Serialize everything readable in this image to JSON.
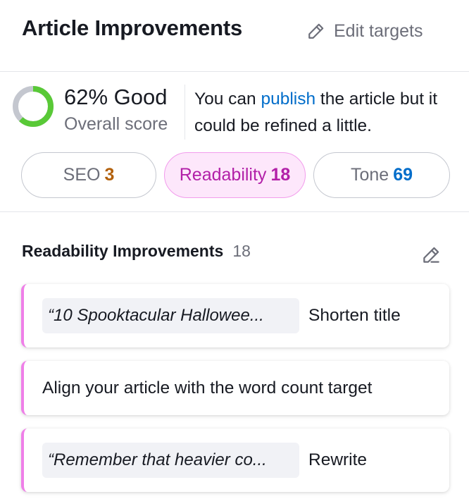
{
  "header": {
    "title": "Article Improvements",
    "edit_targets_label": "Edit targets",
    "edit_icon": "pencil-icon"
  },
  "score": {
    "percent": 62,
    "value_text": "62% Good",
    "label": "Overall score",
    "ring_color": "#59c937",
    "track_color": "#c4c7cf",
    "message_before": "You can ",
    "message_link": "publish",
    "message_after": " the article but it could be refined a little."
  },
  "tabs": [
    {
      "label": "SEO",
      "count": "3",
      "active": false
    },
    {
      "label": "Readability",
      "count": "18",
      "active": true
    },
    {
      "label": "Tone",
      "count": "69",
      "active": false
    }
  ],
  "section": {
    "title": "Readability Improvements",
    "count": "18",
    "edit_icon": "pencil-icon"
  },
  "improvements": [
    {
      "quote": "“10 Spooktacular Hallowee...",
      "action": "Shorten title"
    },
    {
      "quote": "",
      "action": "Align your article with the word count target"
    },
    {
      "quote": "“Remember that heavier co...",
      "action": "Rewrite"
    }
  ],
  "colors": {
    "accent_readability": "#b220a8",
    "card_border": "#ef7fe8",
    "link": "#006dca",
    "seo_count": "#b2600b",
    "tone_count": "#006dca"
  }
}
